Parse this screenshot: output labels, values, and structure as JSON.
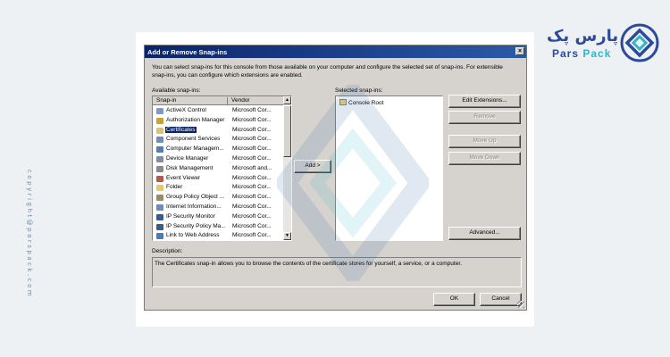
{
  "brand": {
    "name_fa": "پارس پک",
    "name_en_1": "Pars",
    "name_en_2": "Pack",
    "copyright": "copyright@parspack.com"
  },
  "dialog": {
    "title": "Add or Remove Snap-ins",
    "close_glyph": "×",
    "intro": "You can select snap-ins for this console from those available on your computer and configure the selected set of snap-ins. For extensible snap-ins, you can configure which extensions are enabled.",
    "available_label": "Available snap-ins:",
    "selected_label": "Selected snap-ins:",
    "description_label": "Description:",
    "description_text": "The Certificates snap-in allows you to browse the contents of the certificate stores for yourself, a service, or a computer."
  },
  "available": {
    "columns": [
      "Snap-in",
      "Vendor"
    ],
    "rows": [
      {
        "name": "ActiveX Control",
        "vendor": "Microsoft Cor...",
        "icon": "activex-icon",
        "color": "#7a9cc6"
      },
      {
        "name": "Authorization Manager",
        "vendor": "Microsoft Cor...",
        "icon": "authorization-icon",
        "color": "#c9a23a"
      },
      {
        "name": "Certificates",
        "vendor": "Microsoft Cor...",
        "icon": "certificate-icon",
        "color": "#d9c27a"
      },
      {
        "name": "Component Services",
        "vendor": "Microsoft Cor...",
        "icon": "component-icon",
        "color": "#6f8fb7"
      },
      {
        "name": "Computer Managem...",
        "vendor": "Microsoft Cor...",
        "icon": "computer-icon",
        "color": "#5a7ca8"
      },
      {
        "name": "Device Manager",
        "vendor": "Microsoft Cor...",
        "icon": "device-icon",
        "color": "#7d8fa5"
      },
      {
        "name": "Disk Management",
        "vendor": "Microsoft and...",
        "icon": "disk-icon",
        "color": "#8a8a8a"
      },
      {
        "name": "Event Viewer",
        "vendor": "Microsoft Cor...",
        "icon": "event-icon",
        "color": "#b35a4a"
      },
      {
        "name": "Folder",
        "vendor": "Microsoft Cor...",
        "icon": "folder-icon",
        "color": "#e3c96a"
      },
      {
        "name": "Group Policy Object ...",
        "vendor": "Microsoft Cor...",
        "icon": "policy-icon",
        "color": "#9a8a6a"
      },
      {
        "name": "Internet Information...",
        "vendor": "Microsoft Cor...",
        "icon": "iis-icon",
        "color": "#6b8db8"
      },
      {
        "name": "IP Security Monitor",
        "vendor": "Microsoft Cor...",
        "icon": "ipsec-monitor-icon",
        "color": "#3a5a8a"
      },
      {
        "name": "IP Security Policy Ma...",
        "vendor": "Microsoft Cor...",
        "icon": "ipsec-policy-icon",
        "color": "#3a5a8a"
      },
      {
        "name": "Link to Web Address",
        "vendor": "Microsoft Cor...",
        "icon": "web-link-icon",
        "color": "#4a7ab8"
      }
    ],
    "selected_row": 2
  },
  "selected": {
    "items": [
      "Console Root"
    ]
  },
  "buttons": {
    "add": "Add >",
    "edit_extensions": "Edit Extensions...",
    "remove": "Remove",
    "move_up": "Move Up",
    "move_down": "Move Down",
    "advanced": "Advanced...",
    "ok": "OK",
    "cancel": "Cancel"
  },
  "colors": {
    "titlebar": "#0a246a",
    "dialog_bg": "#d6d3ce",
    "brand": "#2d4a9a",
    "brand_accent": "#31b6c8"
  }
}
